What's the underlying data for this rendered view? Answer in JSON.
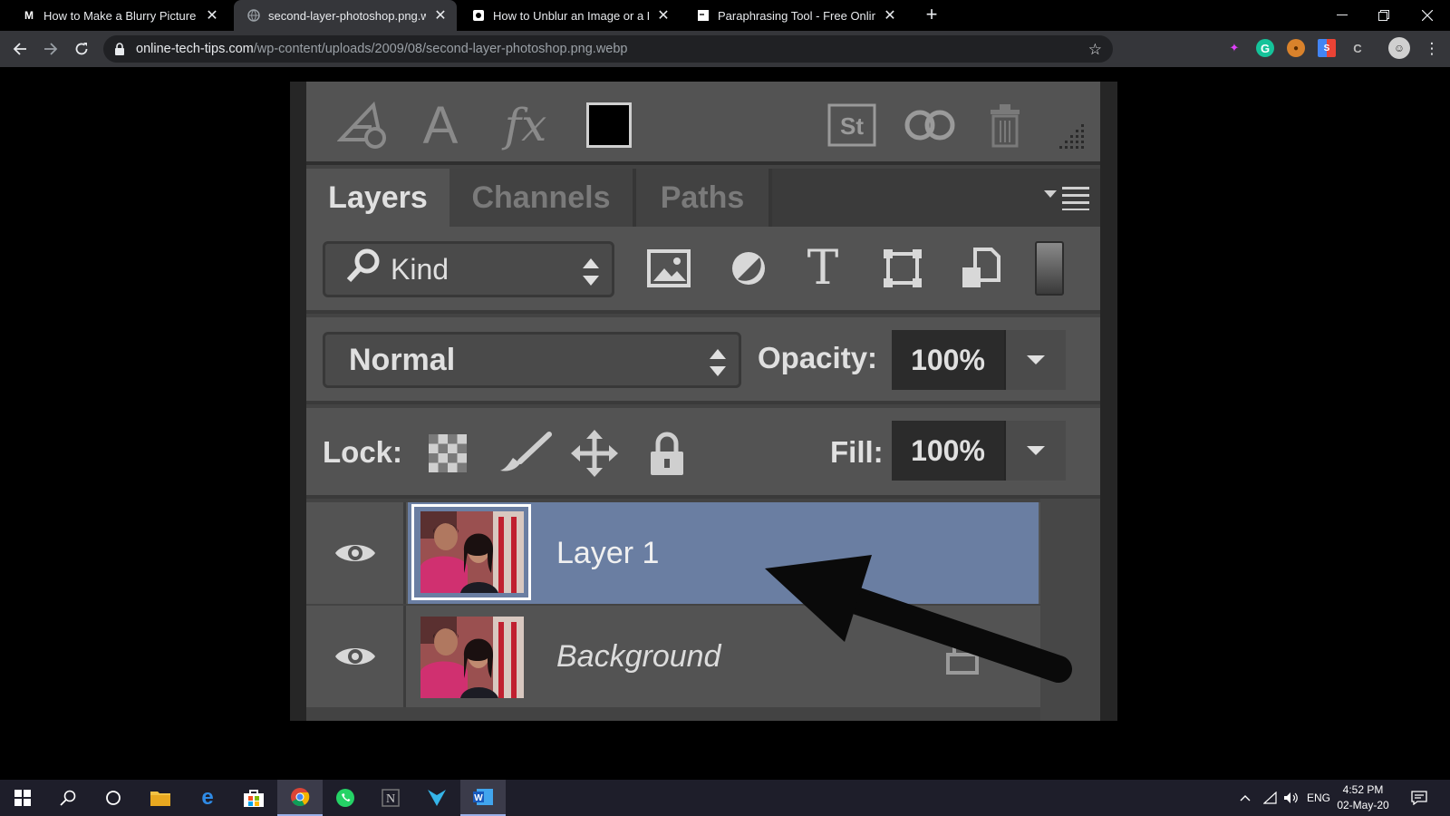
{
  "browser": {
    "tabs": [
      {
        "title": "How to Make a Blurry Picture Cle",
        "favicon": "M",
        "active": false
      },
      {
        "title": "second-layer-photoshop.png.wel",
        "favicon": "globe",
        "active": true
      },
      {
        "title": "How to Unblur an Image or a Pho",
        "favicon": "image",
        "active": false
      },
      {
        "title": "Paraphrasing Tool - Free Online T",
        "favicon": "page",
        "active": false
      }
    ],
    "url_host": "online-tech-tips.com",
    "url_path": "/wp-content/uploads/2009/08/second-layer-photoshop.png.webp"
  },
  "photoshop": {
    "tabs": [
      "Layers",
      "Channels",
      "Paths"
    ],
    "active_tab": "Layers",
    "filter_kind": "Kind",
    "blend_mode": "Normal",
    "opacity_label": "Opacity:",
    "opacity_value": "100%",
    "lock_label": "Lock:",
    "fill_label": "Fill:",
    "fill_value": "100%",
    "layers": [
      {
        "name": "Layer 1",
        "selected": true,
        "visible": true,
        "locked": false
      },
      {
        "name": "Background",
        "selected": false,
        "visible": true,
        "locked": true
      }
    ]
  },
  "taskbar": {
    "language": "ENG",
    "time": "4:52 PM",
    "date": "02-May-20"
  },
  "colors": {
    "layer_selected": "#6a7ea2",
    "panel_bg": "#535353",
    "chrome_toolbar": "#35363a"
  }
}
